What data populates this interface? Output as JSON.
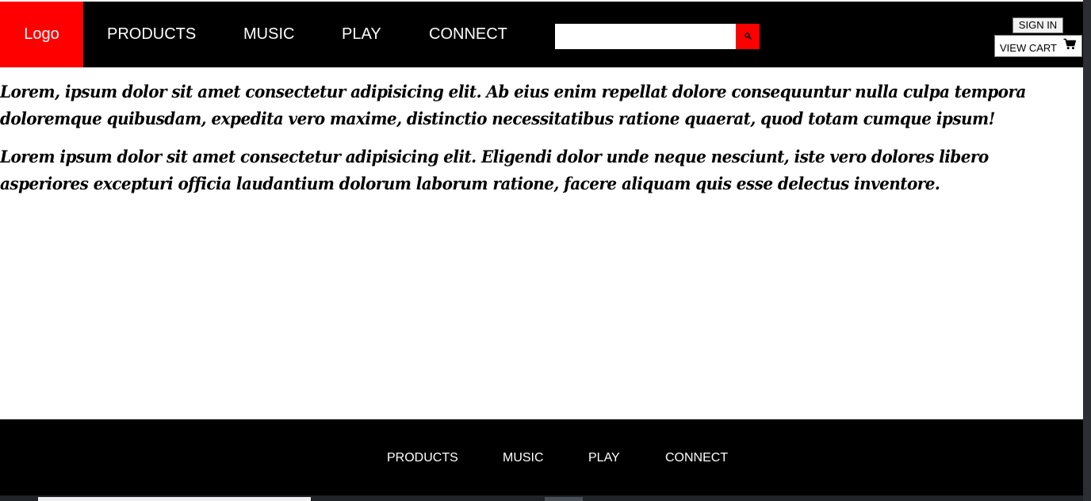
{
  "header": {
    "logo": "Logo",
    "nav": [
      {
        "label": "PRODUCTS"
      },
      {
        "label": "MUSIC"
      },
      {
        "label": "PLAY"
      },
      {
        "label": "CONNECT"
      }
    ],
    "search": {
      "value": "",
      "placeholder": ""
    },
    "sign_in_label": "SIGN IN",
    "view_cart_label": "VIEW CART"
  },
  "main": {
    "paragraphs": [
      "Lorem, ipsum dolor sit amet consectetur adipisicing elit. Ab eius enim repellat dolore consequuntur nulla culpa tempora doloremque quibusdam, expedita vero maxime, distinctio necessitatibus ratione quaerat, quod totam cumque ipsum!",
      "Lorem ipsum dolor sit amet consectetur adipisicing elit. Eligendi dolor unde neque nesciunt, iste vero dolores libero asperiores excepturi officia laudantium dolorum laborum ratione, facere aliquam quis esse delectus inventore."
    ]
  },
  "footer": {
    "nav": [
      {
        "label": "PRODUCTS"
      },
      {
        "label": "MUSIC"
      },
      {
        "label": "PLAY"
      },
      {
        "label": "CONNECT"
      }
    ]
  },
  "icons": {
    "search": "search-icon",
    "cart": "shopping-cart-icon"
  },
  "colors": {
    "accent": "#ff0000",
    "header_bg": "#000000",
    "footer_bg": "#000000",
    "text": "#000000"
  }
}
